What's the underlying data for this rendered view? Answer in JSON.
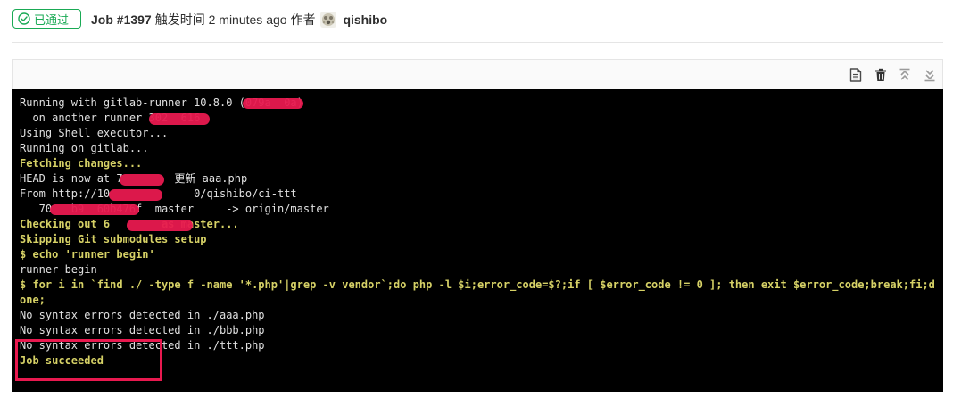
{
  "header": {
    "status_label": "已通过",
    "job_id": "Job #1397",
    "meta": "触发时间 2 minutes ago 作者",
    "author": "qishibo"
  },
  "toolbar": {
    "icons": [
      "raw-log-icon",
      "erase-icon",
      "scroll-top-icon",
      "scroll-bottom-icon"
    ]
  },
  "log": {
    "lines": [
      {
        "text": "Running with gitlab-runner 10.8.0 (079a  0a)",
        "type": "plain"
      },
      {
        "text": "  on another runner 302  616",
        "type": "plain"
      },
      {
        "text": "Using Shell executor...",
        "type": "plain"
      },
      {
        "text": "Running on gitlab...",
        "type": "plain"
      },
      {
        "text": "Fetching changes...",
        "type": "cmd"
      },
      {
        "text": "HEAD is now at 7        更新 aaa.php",
        "type": "plain"
      },
      {
        "text": "From http://10             0/qishibo/ci-ttt",
        "type": "plain"
      },
      {
        "text": "   70   b9  60b476f  master     -> origin/master",
        "type": "plain"
      },
      {
        "text": "Checking out 6        as master...",
        "type": "cmd"
      },
      {
        "text": "Skipping Git submodules setup",
        "type": "cmd"
      },
      {
        "text": "$ echo 'runner begin'",
        "type": "cmd"
      },
      {
        "text": "runner begin",
        "type": "plain"
      },
      {
        "text": "$ for i in `find ./ -type f -name '*.php'|grep -v vendor`;do php -l $i;error_code=$?;if [ $error_code != 0 ]; then exit $error_code;break;fi;d",
        "type": "cmd"
      },
      {
        "text": "one;",
        "type": "cmd"
      },
      {
        "text": "No syntax errors detected in ./aaa.php",
        "type": "plain"
      },
      {
        "text": "No syntax errors detected in ./bbb.php",
        "type": "plain"
      },
      {
        "text": "No syntax errors detected in ./ttt.php",
        "type": "plain"
      },
      {
        "text": "Job succeeded",
        "type": "cmd"
      }
    ]
  },
  "colors": {
    "success": "#1aaa55",
    "terminal_bg": "#000000",
    "terminal_text": "#e0e0e0",
    "terminal_cmd": "#d6d166",
    "annotation": "#e8194f"
  }
}
